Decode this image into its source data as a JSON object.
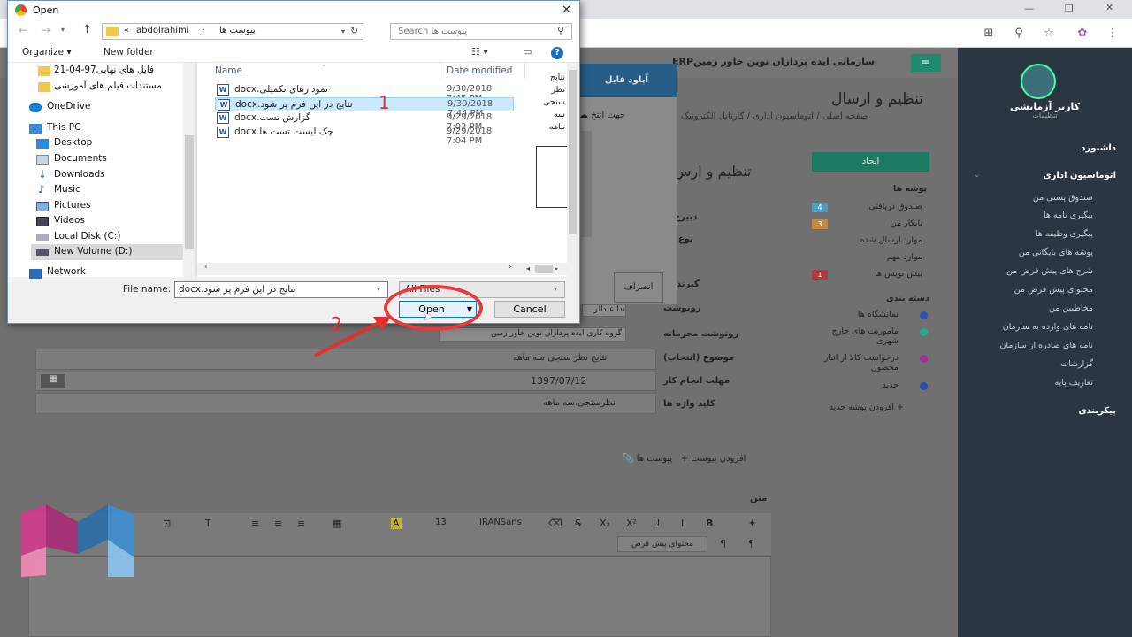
{
  "browser": {
    "icons": [
      "translate-icon",
      "zoom-icon",
      "star-icon",
      "extension-icon",
      "menu-icon"
    ]
  },
  "app": {
    "brand": "سازمانی ایده پردازان نوین خاور زمینERP",
    "page_title": "تنظیم و ارسال",
    "breadcrumb": [
      "صفحه اصلی",
      "اتوماسیون اداری",
      "کارتابل الکترونیک"
    ],
    "user": {
      "name": "کاربر آزمایشی",
      "sub": "تنظیمات"
    },
    "sidebar": [
      {
        "label": "داشبورد"
      },
      {
        "label": "اتوماسیون اداری"
      },
      {
        "label": "صندوق پستی من"
      },
      {
        "label": "پیگیری نامه ها"
      },
      {
        "label": "پیگیری وظیفه ها"
      },
      {
        "label": "پوشه های بایگانی من"
      },
      {
        "label": "شرح های پیش فرض من"
      },
      {
        "label": "محتوای پیش فرض من"
      },
      {
        "label": "مخاطبین من"
      },
      {
        "label": "نامه های وارده به سازمان"
      },
      {
        "label": "نامه های صادره از سازمان"
      },
      {
        "label": "گزارشات"
      },
      {
        "label": "تعاریف پایه"
      },
      {
        "label": "پیکربندی"
      }
    ],
    "create_button": "ایجاد",
    "folders_title": "پوشه ها",
    "folders": [
      {
        "label": "صندوق دریافتی",
        "count": "4"
      },
      {
        "label": "بایکار من",
        "count": "3"
      },
      {
        "label": "موارد ارسال شده",
        "count": ""
      },
      {
        "label": "موارد مهم",
        "count": ""
      },
      {
        "label": "پیش نویس ها",
        "count": "1"
      }
    ],
    "categories_title": "دسته بندی",
    "categories": [
      "نمایشگاه ها",
      "ماموریت های خارج شهری",
      "درخواست کالا از انبار محصول",
      "جدید"
    ],
    "add_folder": "افزودن پوشه جدید",
    "form_title": "تنظیم و ارس",
    "form_labels": [
      "دبیرخ",
      "نوع مح",
      "گیرند",
      "رونوشت",
      "رونوشت محرمانه",
      "موضوع (انتخاب)",
      "مهلت انجام کار",
      "کلید واژه ها"
    ],
    "form_values": {
      "cc_chip": "گروه کاری ایده پردازان نوین خاور زمین",
      "cc_chip2": "ندا عبدالر",
      "subject": "نتایج نظر سنجی سه ماهه",
      "deadline": "1397/07/12",
      "keywords": "نظرسنجی،سه ماهه"
    },
    "attachments": "پیوست ها",
    "add_attachment": "افزودن پیوست",
    "body_label": "متن",
    "editor": {
      "font": "IRANSans",
      "size": "13",
      "default_content": "محتوای پیش فرض"
    }
  },
  "upload_modal": {
    "title": "آپلود فایل",
    "hint": "جهت انتخ",
    "cancel": "انصراف",
    "send": "ارسا",
    "preview_words": [
      "نتایج",
      "نظر",
      "سنجی",
      "سه",
      "ماهه"
    ]
  },
  "dialog": {
    "title": "Open",
    "path": [
      "abdolrahimi",
      "پیوست ها"
    ],
    "path_prefix": "«",
    "search_placeholder": "Search پیوست ها",
    "organize": "Organize",
    "new_folder": "New folder",
    "nav": [
      {
        "label": "فایل های نهایی97-04-21",
        "icon": "folder-icon"
      },
      {
        "label": "مستندات فیلم های آموزشی",
        "icon": "folder-icon"
      },
      {
        "label": "OneDrive",
        "icon": "cloud-icon"
      },
      {
        "label": "This PC",
        "icon": "pc-icon"
      },
      {
        "label": "Desktop",
        "icon": "desktop-icon"
      },
      {
        "label": "Documents",
        "icon": "documents-icon"
      },
      {
        "label": "Downloads",
        "icon": "downloads-icon"
      },
      {
        "label": "Music",
        "icon": "music-icon"
      },
      {
        "label": "Pictures",
        "icon": "pictures-icon"
      },
      {
        "label": "Videos",
        "icon": "videos-icon"
      },
      {
        "label": "Local Disk (C:)",
        "icon": "drive-icon"
      },
      {
        "label": "New Volume (D:)",
        "icon": "drive-icon"
      },
      {
        "label": "Network",
        "icon": "network-icon"
      }
    ],
    "columns": {
      "name": "Name",
      "date": "Date modified"
    },
    "files": [
      {
        "name": "نمودارهای تکمیلی.docx",
        "date": "9/30/2018 7:45 PM",
        "selected": false
      },
      {
        "name": "نتایج در این فرم پر شود.docx",
        "date": "9/30/2018 7:44 PM",
        "selected": true
      },
      {
        "name": "گزارش تست.docx",
        "date": "9/29/2018 7:02 PM",
        "selected": false
      },
      {
        "name": "چک لیست تست ها.docx",
        "date": "9/29/2018 7:04 PM",
        "selected": false
      }
    ],
    "filename_label": "File name:",
    "filename_value": "نتایج در این فرم پر شود.docx",
    "filetype": "All Files",
    "open": "Open",
    "cancel": "Cancel"
  },
  "annotations": {
    "step1": "1",
    "step2": "2"
  }
}
